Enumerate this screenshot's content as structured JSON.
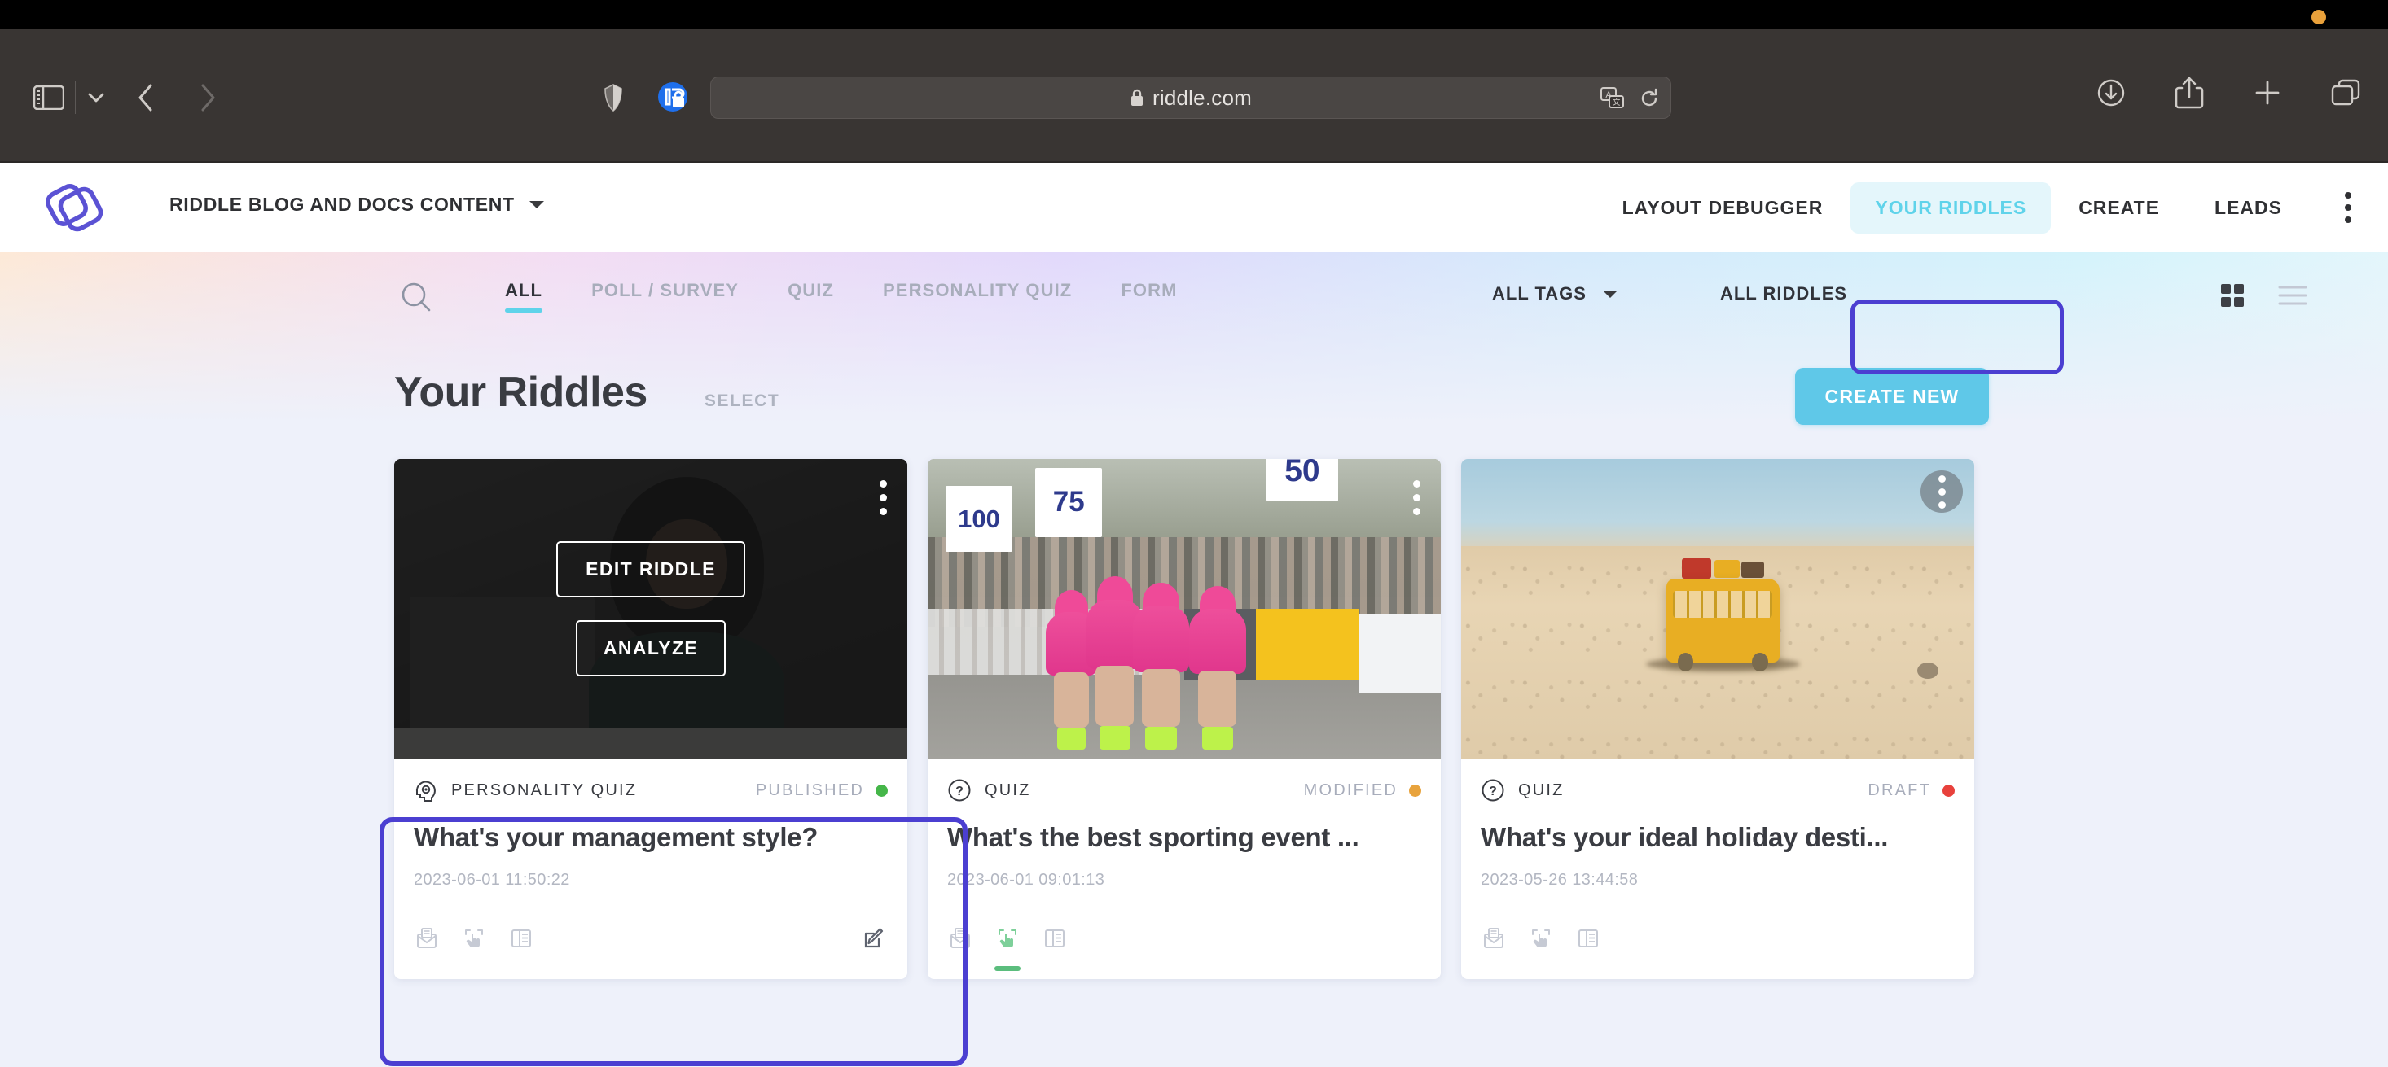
{
  "browser": {
    "url": "riddle.com",
    "icons": {
      "sidebar": "sidebar-toggle-icon",
      "tab_group_chevron": "chevron-down-icon",
      "back": "back-arrow-icon",
      "forward": "forward-arrow-icon",
      "shield": "privacy-shield-icon",
      "reader": "reader-mode-icon",
      "lock": "lock-icon",
      "translate": "translate-icon",
      "reload": "reload-icon",
      "download": "download-icon",
      "share": "share-icon",
      "new_tab": "plus-icon",
      "tab_overview": "tab-overview-icon"
    }
  },
  "app_header": {
    "logo": "riddle-logo",
    "workspace": "RIDDLE BLOG AND DOCS CONTENT",
    "nav": [
      {
        "label": "LAYOUT DEBUGGER",
        "active": false
      },
      {
        "label": "YOUR RIDDLES",
        "active": true
      },
      {
        "label": "CREATE",
        "active": false
      },
      {
        "label": "LEADS",
        "active": false
      }
    ],
    "overflow_menu": "kebab-menu-icon"
  },
  "toolbar": {
    "search_icon": "search-icon",
    "tabs": [
      {
        "label": "ALL",
        "active": true
      },
      {
        "label": "POLL / SURVEY",
        "active": false
      },
      {
        "label": "QUIZ",
        "active": false
      },
      {
        "label": "PERSONALITY QUIZ",
        "active": false
      },
      {
        "label": "FORM",
        "active": false
      }
    ],
    "all_tags": "ALL TAGS",
    "all_riddles": "ALL RIDDLES",
    "view_grid": "grid-view-icon",
    "view_list": "list-view-icon"
  },
  "page": {
    "title": "Your Riddles",
    "select_label": "SELECT",
    "create_new_label": "CREATE NEW"
  },
  "cards": [
    {
      "type_label": "PERSONALITY QUIZ",
      "type_icon": "head-gear-icon",
      "status_label": "PUBLISHED",
      "status_color": "#45b649",
      "title": "What's your management style?",
      "date": "2023-06-01 11:50:22",
      "image": "woman-at-laptop-photo",
      "hovered": true,
      "overlay_buttons": [
        {
          "label": "EDIT RIDDLE"
        },
        {
          "label": "ANALYZE"
        }
      ],
      "footer_icons": [
        "lead-capture-icon",
        "interaction-icon",
        "layout-icon"
      ],
      "has_edit_icon": true,
      "active_footer_icon": null
    },
    {
      "type_label": "QUIZ",
      "type_icon": "question-mark-icon",
      "status_label": "MODIFIED",
      "status_color": "#e8a33d",
      "title": "What's the best sporting event ...",
      "date": "2023-06-01 09:01:13",
      "image": "cyclists-race-photo",
      "hovered": false,
      "overlay_buttons": [],
      "footer_icons": [
        "lead-capture-icon",
        "interaction-icon",
        "layout-icon"
      ],
      "has_edit_icon": false,
      "active_footer_icon": 1
    },
    {
      "type_label": "QUIZ",
      "type_icon": "question-mark-icon",
      "status_label": "DRAFT",
      "status_color": "#e8413c",
      "title": "What's your ideal holiday desti...",
      "date": "2023-05-26 13:44:58",
      "image": "yellow-van-on-sand-photo",
      "hovered": false,
      "overlay_buttons": [],
      "footer_icons": [
        "lead-capture-icon",
        "interaction-icon",
        "layout-icon"
      ],
      "has_edit_icon": false,
      "active_footer_icon": null
    }
  ],
  "image_text": {
    "cycling_signs": [
      "100",
      "75",
      "50"
    ]
  },
  "colors": {
    "accent_cyan": "#5fc8e8",
    "focus_purple": "#4b3fd1",
    "brand_purple": "#5b52d4",
    "page_bg": "#eef1fa"
  }
}
